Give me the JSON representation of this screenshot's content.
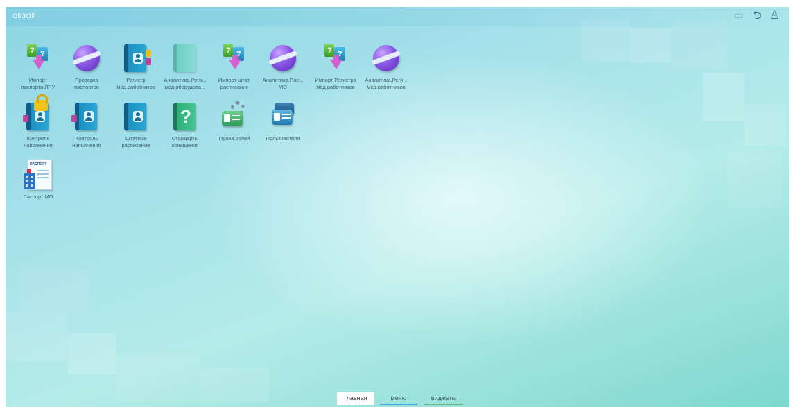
{
  "window": {
    "title": "ОБЗОР"
  },
  "toolbar": {
    "icons": [
      "window-icon",
      "undo-icon",
      "user-icon"
    ]
  },
  "apps": [
    {
      "label": "Импорт\nпаспорта ЛПУ",
      "icon": "import-icon"
    },
    {
      "label": "Проверка\nпаспортов",
      "icon": "globe-icon"
    },
    {
      "label": "Регистр\nмед.работников",
      "icon": "registry-book-icon"
    },
    {
      "label": "Аналитика.Реги...\nмед.оборудова...",
      "icon": "analytics-book-icon"
    },
    {
      "label": "Импорт штат.\nрасписания",
      "icon": "import-icon"
    },
    {
      "label": "Аналитика.Пас...\nМО",
      "icon": "globe-icon"
    },
    {
      "label": "Импорт Регистра\nмед.работников",
      "icon": "import-icon"
    },
    {
      "label": "Аналитика.Реги...\nмед.работников",
      "icon": "globe-icon"
    },
    {
      "label": "Контроль\nнаполнения",
      "icon": "locked-book-icon"
    },
    {
      "label": "Контроль\nнаполнения",
      "icon": "book-icon"
    },
    {
      "label": "Штатное\nрасписание",
      "icon": "staff-book-icon"
    },
    {
      "label": "Стандарты\nоснащения",
      "icon": "question-book-icon"
    },
    {
      "label": "Права ролей",
      "icon": "role-card-gear-icon"
    },
    {
      "label": "Пользователи",
      "icon": "users-cards-icon"
    },
    {
      "label": "Паспорт МО",
      "icon": "passport-document-icon"
    }
  ],
  "passport_doc_header": "ПАСПОРТ",
  "bottom_tabs": [
    {
      "label": "главная",
      "active": true
    },
    {
      "label": "меню",
      "active": false
    },
    {
      "label": "виджеты",
      "active": false
    }
  ],
  "colors": {
    "background_start": "#8fd6e4",
    "background_end": "#7cd8cf",
    "label_text": "#3d6270",
    "tab_underline": "#4ba3d6"
  }
}
